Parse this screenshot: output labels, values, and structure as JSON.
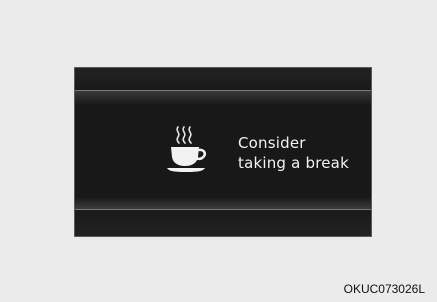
{
  "display": {
    "message_line1": "Consider",
    "message_line2": "taking a break",
    "icon": "coffee-cup-icon"
  },
  "caption": "OKUC073026L",
  "colors": {
    "background": "#ebebeb",
    "screen": "#1c1c1c",
    "text": "#f2f2f2"
  }
}
